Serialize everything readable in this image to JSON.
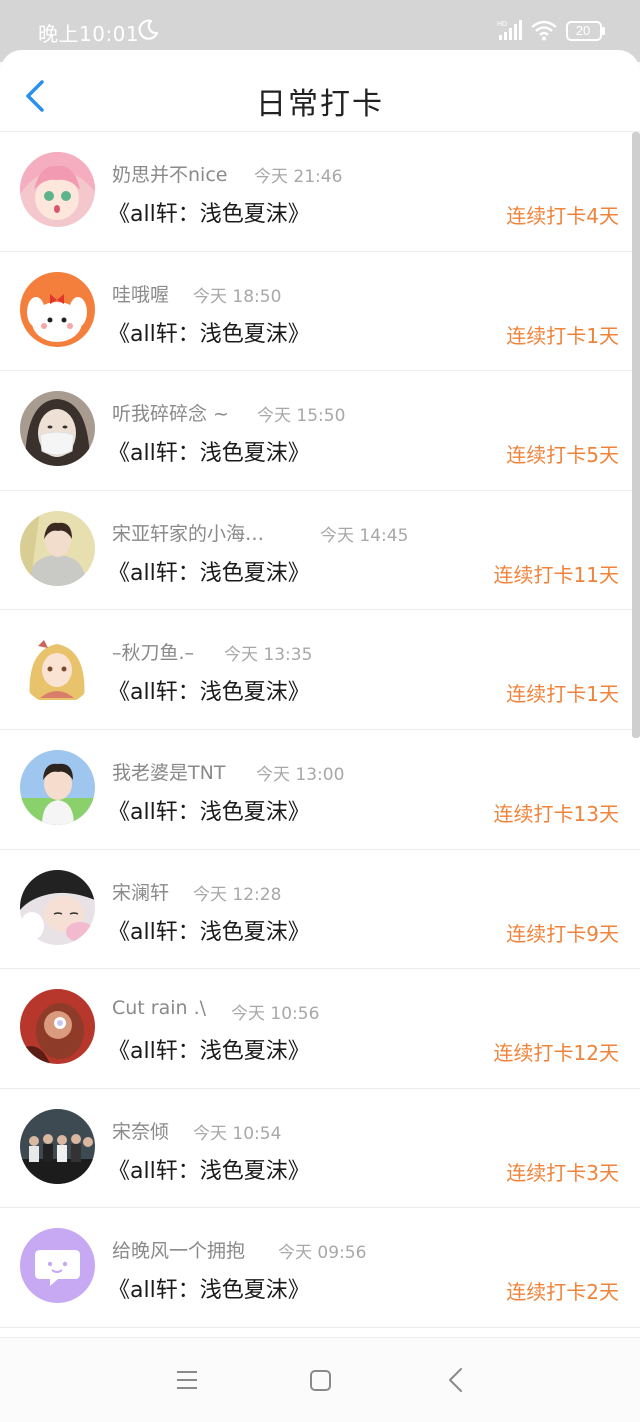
{
  "status_bar": {
    "time": "晚上10:01",
    "battery": "20"
  },
  "header": {
    "title": "日常打卡"
  },
  "entries": [
    {
      "name": "奶思并不nice",
      "time": "今天 21:46",
      "title": "《all轩：浅色夏沫》",
      "streak": "连续打卡4天",
      "avatar": "avatar-anime-girl-pink"
    },
    {
      "name": "哇哦喔",
      "time": "今天 18:50",
      "title": "《all轩：浅色夏沫》",
      "streak": "连续打卡1天",
      "avatar": "avatar-white-puppy"
    },
    {
      "name": "听我碎碎念 ~",
      "time": "今天 15:50",
      "title": "《all轩：浅色夏沫》",
      "streak": "连续打卡5天",
      "avatar": "avatar-girl-mask"
    },
    {
      "name": "宋亚轩家的小海…",
      "time": "今天 14:45",
      "title": "《all轩：浅色夏沫》",
      "streak": "连续打卡11天",
      "avatar": "avatar-boy-hoodie"
    },
    {
      "name": "–秋刀鱼.–",
      "time": "今天 13:35",
      "title": "《all轩：浅色夏沫》",
      "streak": "连续打卡1天",
      "avatar": "avatar-anime-girl-blonde"
    },
    {
      "name": "我老婆是TNT",
      "time": "今天 13:00",
      "title": "《all轩：浅色夏沫》",
      "streak": "连续打卡13天",
      "avatar": "avatar-boy-sky"
    },
    {
      "name": "宋澜轩",
      "time": "今天 12:28",
      "title": "《all轩：浅色夏沫》",
      "streak": "连续打卡9天",
      "avatar": "avatar-sleeping-girl"
    },
    {
      "name": "Cut rain .\\",
      "time": "今天 10:56",
      "title": "《all轩：浅色夏沫》",
      "streak": "连续打卡12天",
      "avatar": "avatar-red-photo"
    },
    {
      "name": "宋奈倾",
      "time": "今天 10:54",
      "title": "《all轩：浅色夏沫》",
      "streak": "连续打卡3天",
      "avatar": "avatar-group-photo"
    },
    {
      "name": "给晚风一个拥抱",
      "time": "今天 09:56",
      "title": "《all轩：浅色夏沫》",
      "streak": "连续打卡2天",
      "avatar": "avatar-chat-bubble-purple"
    }
  ],
  "colors": {
    "accent": "#2b8ff2",
    "streak": "#f0833a",
    "status_bar": "#d5d5d5"
  }
}
